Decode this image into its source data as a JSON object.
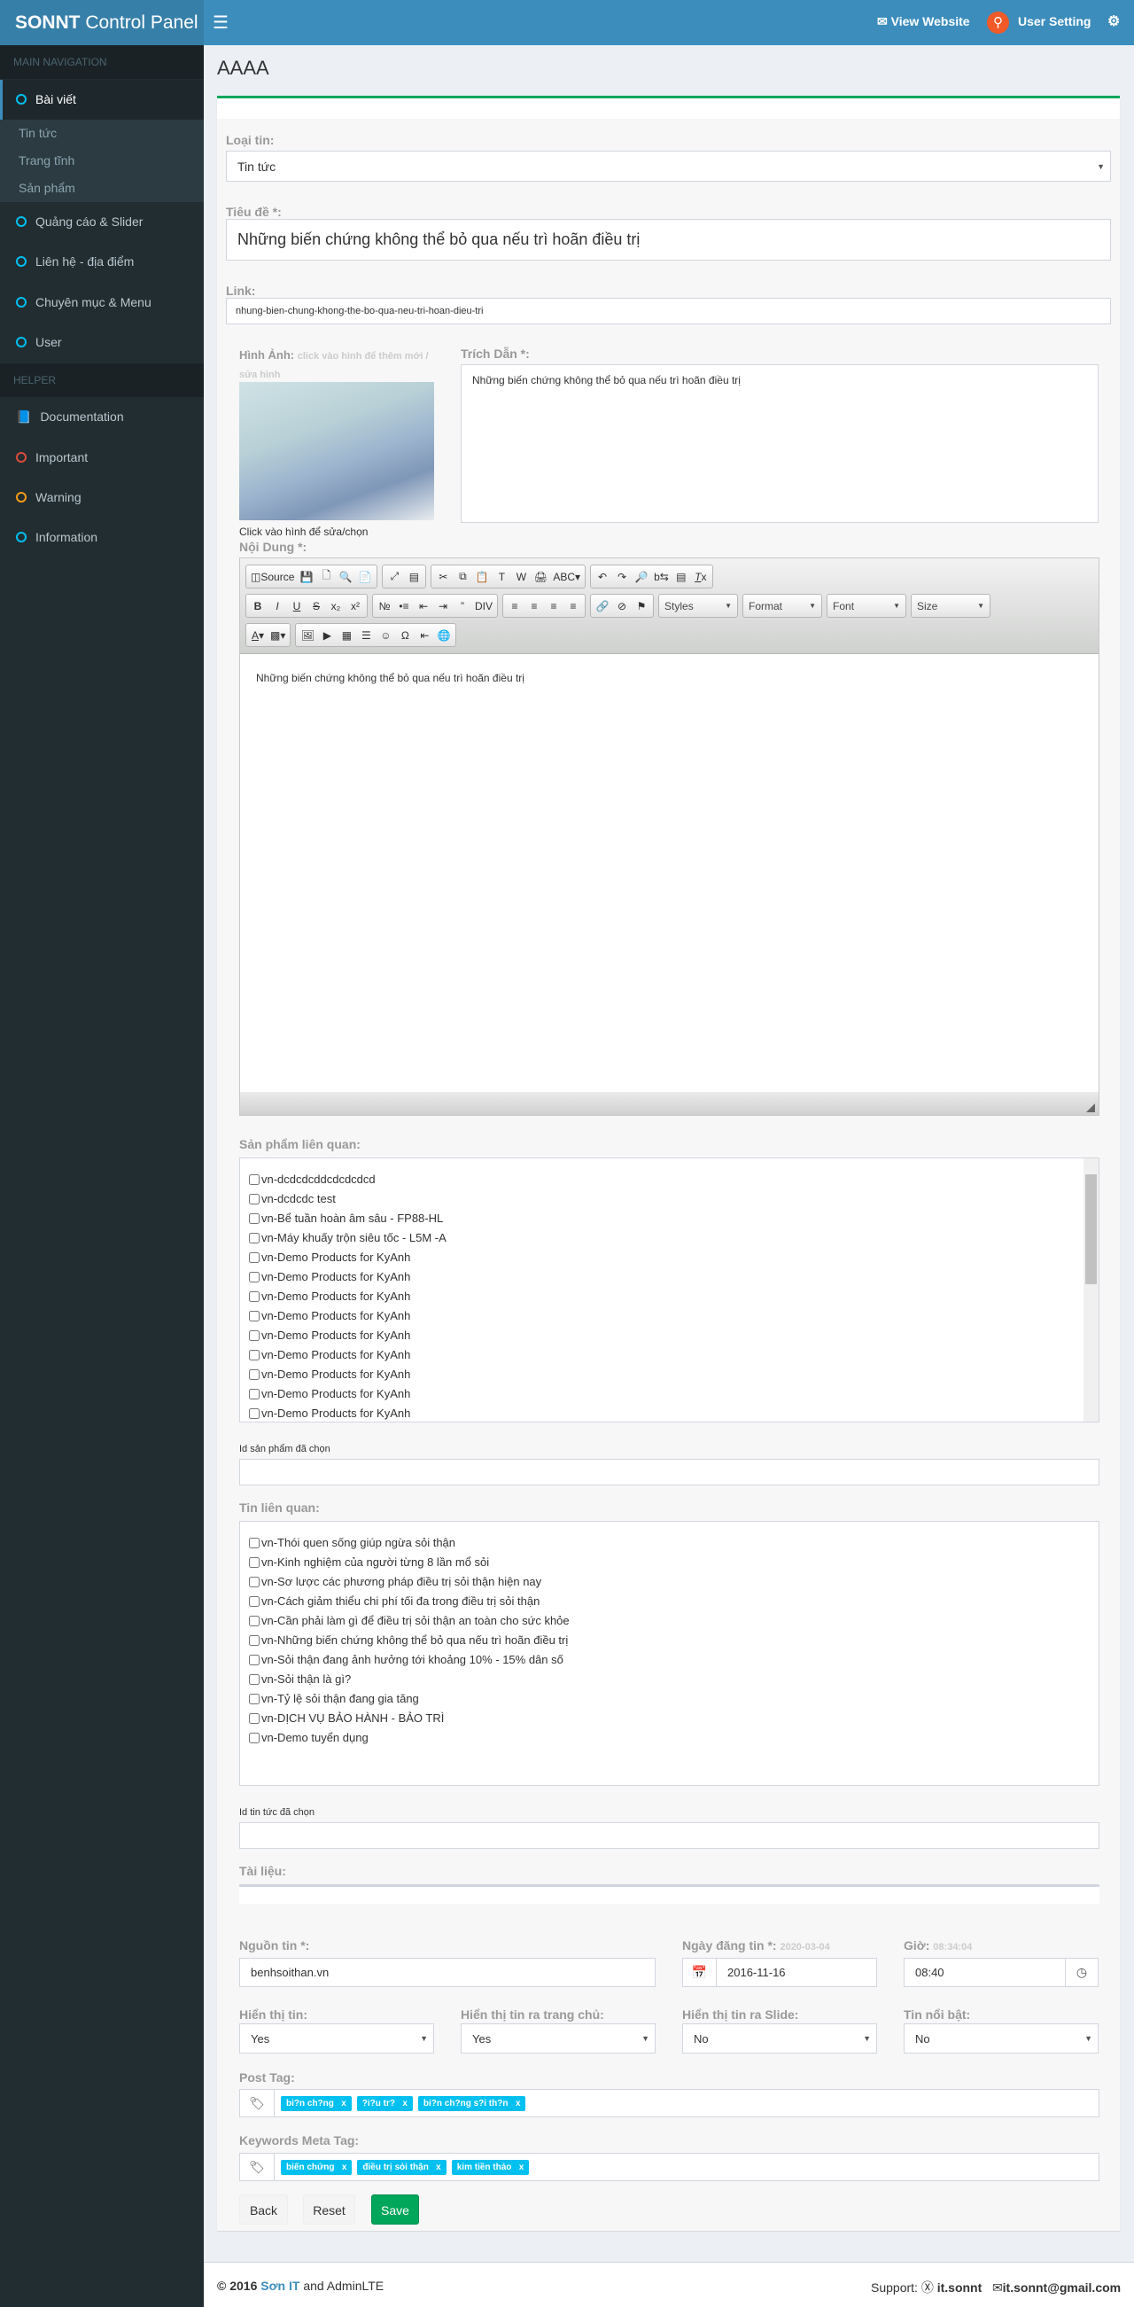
{
  "header": {
    "logo_bold": "SONNT",
    "logo_rest": " Control Panel",
    "view_website": "View Website",
    "user_setting": "User Setting"
  },
  "sidebar": {
    "main_nav": "MAIN NAVIGATION",
    "helper": "HELPER",
    "active": "Bài viết",
    "sub": [
      "Tin tức",
      "Trang tĩnh",
      "Sản phẩm"
    ],
    "items": [
      "Quảng cáo & Slider",
      "Liên hệ - địa điểm",
      "Chuyên mục & Menu",
      "User"
    ],
    "helper_items": [
      {
        "label": "Documentation",
        "icon": "book-icon"
      },
      {
        "label": "Important",
        "color": "#dd4b39"
      },
      {
        "label": "Warning",
        "color": "#f39c12"
      },
      {
        "label": "Information",
        "color": "#00c0ef"
      }
    ]
  },
  "page": {
    "title": "AAAA"
  },
  "form": {
    "type_label": "Loại tin:",
    "type_value": "Tin tức",
    "title_label": "Tiêu đề *:",
    "title_value": "Những biến chứng không thể bỏ qua nếu trì hoãn điều trị",
    "link_label": "Link:",
    "link_value": "nhung-bien-chung-khong-the-bo-qua-neu-tri-hoan-dieu-tri",
    "image_label": "Hình Ảnh:",
    "image_hint": "click vào hình để thêm mới / sửa hình",
    "image_caption": "Click vào hình để sửa/chọn",
    "quote_label": "Trích Dẫn *:",
    "quote_value": "Những biến chứng không thể bỏ qua nếu trì hoãn điều trị",
    "content_label": "Nội Dung *:",
    "content_value": "Những biến chứng không thể bỏ qua nếu trì hoãn điều trị",
    "editor": {
      "source": "Source",
      "combos": [
        "Styles",
        "Format",
        "Font",
        "Size"
      ],
      "row1": [
        [
          "source",
          "save",
          "newpage",
          "preview",
          "templates"
        ],
        [
          "maximize",
          "showblocks"
        ],
        [
          "cut",
          "copy",
          "paste",
          "pastetext",
          "pasteword",
          "print",
          "spellcheck"
        ],
        [
          "undo",
          "redo",
          "find",
          "replace",
          "selectall",
          "removeformat"
        ]
      ],
      "row2": [
        [
          "bold",
          "italic",
          "underline",
          "strike",
          "subscript",
          "superscript"
        ],
        [
          "numberedlist",
          "bulletedlist",
          "outdent",
          "indent",
          "blockquote",
          "creatediv"
        ],
        [
          "alignleft",
          "aligncenter",
          "alignright",
          "justify"
        ],
        [
          "link",
          "unlink",
          "anchor"
        ]
      ],
      "row3": [
        [
          "textcolor",
          "bgcolor"
        ],
        [
          "image",
          "youtube",
          "table",
          "horizontalrule",
          "smiley",
          "specialchar",
          "pagebreak",
          "iframe"
        ]
      ]
    },
    "products_label": "Sản phẩm liên quan:",
    "products": [
      "vn-dcdcdcddcdcdcdcd",
      "vn-dcdcdc test",
      "vn-Bể tuần hoàn âm sâu - FP88-HL",
      "vn-Máy khuấy trộn siêu tốc - L5M -A",
      "vn-Demo Products for KyAnh",
      "vn-Demo Products for KyAnh",
      "vn-Demo Products for KyAnh",
      "vn-Demo Products for KyAnh",
      "vn-Demo Products for KyAnh",
      "vn-Demo Products for KyAnh",
      "vn-Demo Products for KyAnh",
      "vn-Demo Products for KyAnh",
      "vn-Demo Products for KyAnh"
    ],
    "product_ids_label": "Id sản phẩm đã chọn",
    "product_ids_value": "",
    "news_label": "Tin liên quan:",
    "news": [
      "vn-Thói quen sống giúp ngừa sỏi thận",
      "vn-Kinh nghiệm của người từng 8 lần mổ sỏi",
      "vn-Sơ lược các phương pháp điều trị sỏi thận hiện nay",
      "vn-Cách giảm thiểu chi phí tối đa trong điều trị sỏi thận",
      "vn-Cần phải làm gì để điều trị sỏi thận an toàn cho sức khỏe",
      "vn-Những biến chứng không thể bỏ qua nếu trì hoãn điều trị",
      "vn-Sỏi thận đang ảnh hưởng tới khoảng 10% - 15% dân số",
      "vn-Sỏi thận là gì?",
      "vn-Tỷ lệ sỏi thận đang gia tăng",
      "vn-DỊCH VỤ BẢO HÀNH - BẢO TRÌ",
      "vn-Demo tuyển dụng"
    ],
    "news_ids_label": "Id tin tức đã chọn",
    "news_ids_value": "",
    "docs_label": "Tài liệu:",
    "source_label": "Nguồn tin *:",
    "source_value": "benhsoithan.vn",
    "date_label": "Ngày đăng tin *:",
    "date_hint": "2020-03-04",
    "date_value": "2016-11-16",
    "time_label": "Giờ:",
    "time_hint": "08:34:04",
    "time_value": "08:40",
    "selects": [
      {
        "label": "Hiển thị tin:",
        "value": "Yes"
      },
      {
        "label": "Hiển thị tin ra trang chủ:",
        "value": "Yes"
      },
      {
        "label": "Hiển thị tin ra Slide:",
        "value": "No"
      },
      {
        "label": "Tin nổi bật:",
        "value": "No"
      }
    ],
    "post_tag_label": "Post Tag:",
    "post_tags": [
      "bi?n ch?ng",
      "?i?u tr?",
      "bi?n ch?ng s?i th?n"
    ],
    "meta_tag_label": "Keywords Meta Tag:",
    "meta_tags": [
      "biến chứng",
      "điều trị sỏi thận",
      "kim tiền thảo"
    ],
    "tag_remove": "x",
    "back": "Back",
    "reset": "Reset",
    "save": "Save"
  },
  "footer": {
    "copy": "© 2016 ",
    "brand": "Sơn IT",
    "rest": " and AdminLTE",
    "support": "Support:",
    "skype": "it.sonnt",
    "email": "it.sonnt@gmail.com"
  },
  "colors": {
    "header": "#3c8dbc",
    "sidebar": "#222d32",
    "accent_green": "#00a65a",
    "tag": "#00c0ef"
  }
}
